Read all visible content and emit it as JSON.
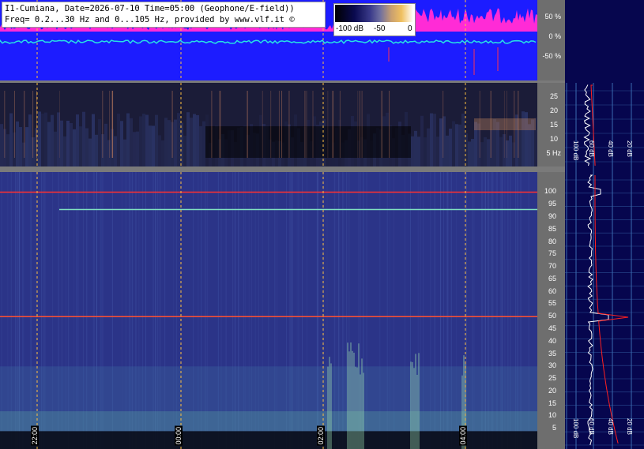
{
  "title": {
    "line1": "I1-Cumiana, Date=2026-07-10 Time=05:00 (Geophone/E-field))",
    "line2": "Freq= 0.2...30 Hz and 0...105 Hz, provided by www.vlf.it ©"
  },
  "colorbar": {
    "ticks": [
      "-100 dB",
      "-50",
      "0"
    ]
  },
  "colors": {
    "waveform_bg": "#1c1cff",
    "waveform_top": "#ff2bd6",
    "trace": "#27e3e3",
    "marker": "#ffc040",
    "axis_bg": "#6e6e6e",
    "right_bg": "#06064e",
    "right_grid": "#3a6ab0"
  },
  "chart_data": [
    {
      "type": "line",
      "name": "waveform",
      "y_ticks": [
        "50 %",
        "0 %",
        "-50 %"
      ],
      "ylim": [
        -100,
        100
      ]
    },
    {
      "type": "heatmap",
      "name": "spectrogram-low",
      "y_ticks": [
        "25",
        "20",
        "15",
        "10",
        "5 Hz"
      ],
      "ylim": [
        0,
        30
      ]
    },
    {
      "type": "heatmap",
      "name": "spectrogram-high",
      "y_ticks": [
        "100",
        "95",
        "90",
        "85",
        "80",
        "75",
        "70",
        "65",
        "60",
        "55",
        "50",
        "45",
        "40",
        "35",
        "30",
        "25",
        "20",
        "15",
        "10",
        "5"
      ],
      "ylim": [
        0,
        105
      ],
      "x_time_labels": [
        "22:00",
        "00:00",
        "02:00",
        "04:00"
      ],
      "features": [
        {
          "freq": 100,
          "color": "#ff3030"
        },
        {
          "freq": 93,
          "color": "#7fe0c0"
        },
        {
          "freq": 50,
          "color": "#ff5030"
        }
      ]
    },
    {
      "type": "line",
      "name": "spectrum-profiles",
      "x_labels_low": [
        "100 dB",
        "60 dB",
        "40 dB",
        "20 dB"
      ],
      "x_labels_high": [
        "100 dB",
        "60 dB",
        "40 dB",
        "20 dB"
      ],
      "peaks_hz": [
        50,
        100
      ]
    }
  ]
}
